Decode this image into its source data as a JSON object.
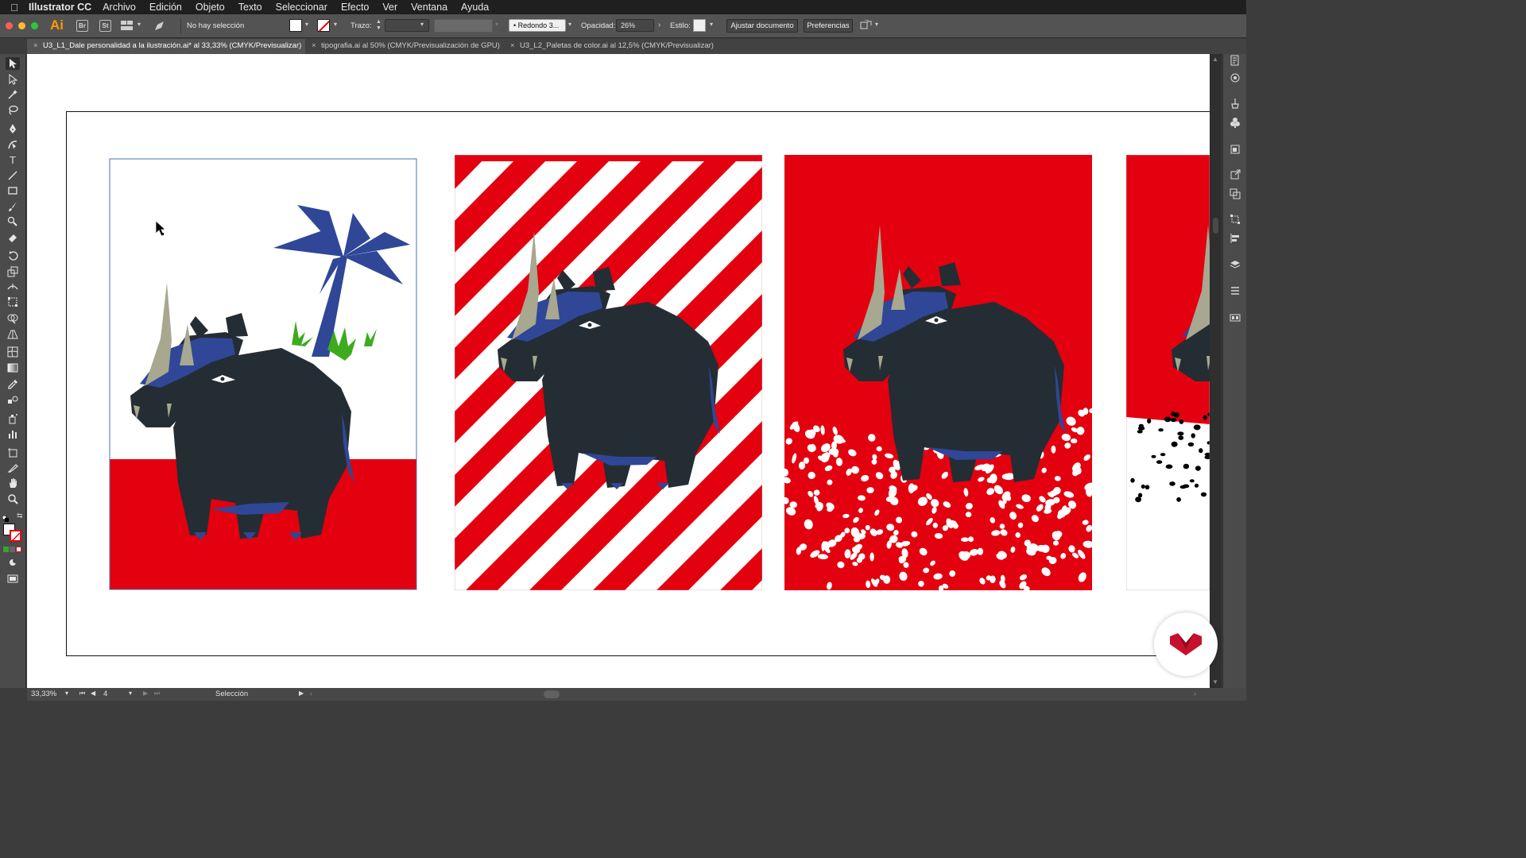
{
  "menubar": {
    "app_name": "Illustrator CC",
    "items": [
      "Archivo",
      "Edición",
      "Objeto",
      "Texto",
      "Seleccionar",
      "Efecto",
      "Ver",
      "Ventana",
      "Ayuda"
    ]
  },
  "controlbar": {
    "br_label": "Br",
    "st_label": "St",
    "ai_logo": "Ai",
    "selection_status": "No hay selección",
    "stroke_label": "Trazo:",
    "brush_label": "Redondo 3...",
    "opacity_label": "Opacidad:",
    "opacity_value": "26%",
    "style_label": "Estilo:",
    "adjust_button": "Ajustar documento",
    "prefs_button": "Preferencias"
  },
  "tabs": [
    {
      "label": "U3_L1_Dale personalidad a la ilustración.ai* al 33,33% (CMYK/Previsualizar)",
      "active": true
    },
    {
      "label": "tipografia.ai al 50% (CMYK/Previsualización de GPU)",
      "active": false
    },
    {
      "label": "U3_L2_Paletas de color.ai al 12,5% (CMYK/Previsualizar)",
      "active": false
    }
  ],
  "statusbar": {
    "zoom": "33,33%",
    "artboard_number": "4",
    "tool_name": "Selección"
  },
  "colors": {
    "red": "#e3000f",
    "rhino_dark": "#242d33",
    "rhino_blue": "#2f4796",
    "horn": "#a8a78f",
    "grass": "#3dab1d",
    "brand_red": "#c8102e"
  },
  "icons": {
    "tools": [
      "selection-icon",
      "direct-selection-icon",
      "magic-wand-icon",
      "lasso-icon",
      "pen-icon",
      "curvature-icon",
      "type-icon",
      "line-icon",
      "rectangle-icon",
      "paintbrush-icon",
      "shaper-icon",
      "eraser-icon",
      "rotate-icon",
      "scale-icon",
      "width-icon",
      "free-transform-icon",
      "shape-builder-icon",
      "perspective-icon",
      "mesh-icon",
      "gradient-icon",
      "eyedropper-icon",
      "blend-icon",
      "symbol-sprayer-icon",
      "graph-icon",
      "artboard-icon",
      "slice-icon",
      "hand-icon",
      "zoom-icon"
    ],
    "right_panels": [
      "properties-icon",
      "navigator-icon",
      "brushes-icon",
      "symbols-icon",
      "graphic-styles-icon",
      "export-icon",
      "pathfinder-icon",
      "transform-icon",
      "align-icon",
      "layers-icon",
      "libraries-icon",
      "swatches-icon"
    ]
  }
}
